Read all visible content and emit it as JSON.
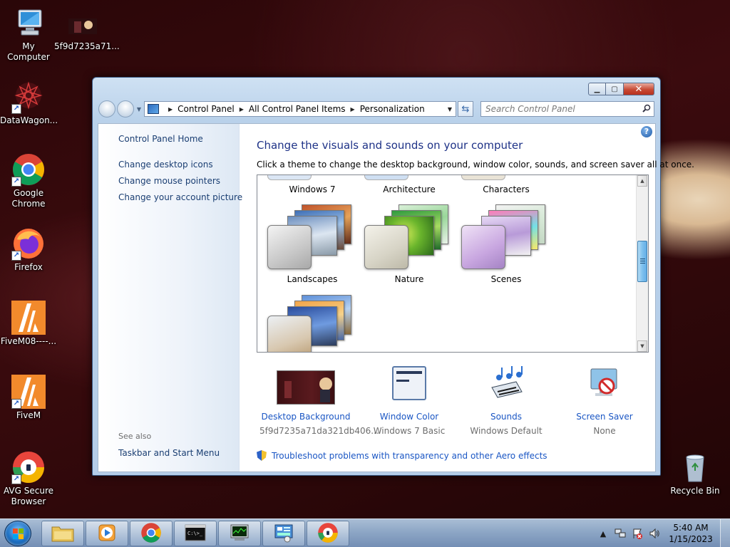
{
  "desktop": {
    "icons": [
      {
        "label": "My Computer",
        "icon": "computer-icon"
      },
      {
        "label": "5f9d7235a71...",
        "icon": "image-file-icon"
      },
      {
        "label": "DataWagon...",
        "icon": "datawagon-icon"
      },
      {
        "label": "Google Chrome",
        "icon": "chrome-icon"
      },
      {
        "label": "Firefox",
        "icon": "firefox-icon"
      },
      {
        "label": "FiveM08----...",
        "icon": "fivem-icon"
      },
      {
        "label": "FiveM",
        "icon": "fivem-icon"
      },
      {
        "label": "AVG Secure Browser",
        "icon": "avg-browser-icon"
      },
      {
        "label": "Recycle Bin",
        "icon": "recycle-bin-icon"
      }
    ]
  },
  "window": {
    "breadcrumb": [
      "Control Panel",
      "All Control Panel Items",
      "Personalization"
    ],
    "search_placeholder": "Search Control Panel",
    "left_pane": {
      "home": "Control Panel Home",
      "links": [
        "Change desktop icons",
        "Change mouse pointers",
        "Change your account picture"
      ],
      "see_also_heading": "See also",
      "see_also_links": [
        "Taskbar and Start Menu"
      ]
    },
    "main": {
      "title": "Change the visuals and sounds on your computer",
      "subtitle": "Click a theme to change the desktop background, window color, sounds, and screen saver all at once.",
      "themes_top_row": [
        "Windows 7",
        "Architecture",
        "Characters"
      ],
      "themes_mid_row": [
        "Landscapes",
        "Nature",
        "Scenes"
      ],
      "bottom": [
        {
          "title": "Desktop Background",
          "value": "5f9d7235a71da321db406...",
          "icon": "wallpaper-thumbnail"
        },
        {
          "title": "Window Color",
          "value": "Windows 7 Basic",
          "icon": "window-color-icon"
        },
        {
          "title": "Sounds",
          "value": "Windows Default",
          "icon": "sounds-icon"
        },
        {
          "title": "Screen Saver",
          "value": "None",
          "icon": "screen-saver-icon"
        }
      ],
      "troubleshoot": "Troubleshoot problems with transparency and other Aero effects"
    }
  },
  "taskbar": {
    "pinned": [
      "file-explorer-icon",
      "media-player-icon",
      "chrome-icon",
      "command-prompt-icon",
      "task-manager-icon",
      "control-panel-icon",
      "avg-browser-icon"
    ],
    "clock": {
      "time": "5:40 AM",
      "date": "1/15/2023"
    }
  }
}
